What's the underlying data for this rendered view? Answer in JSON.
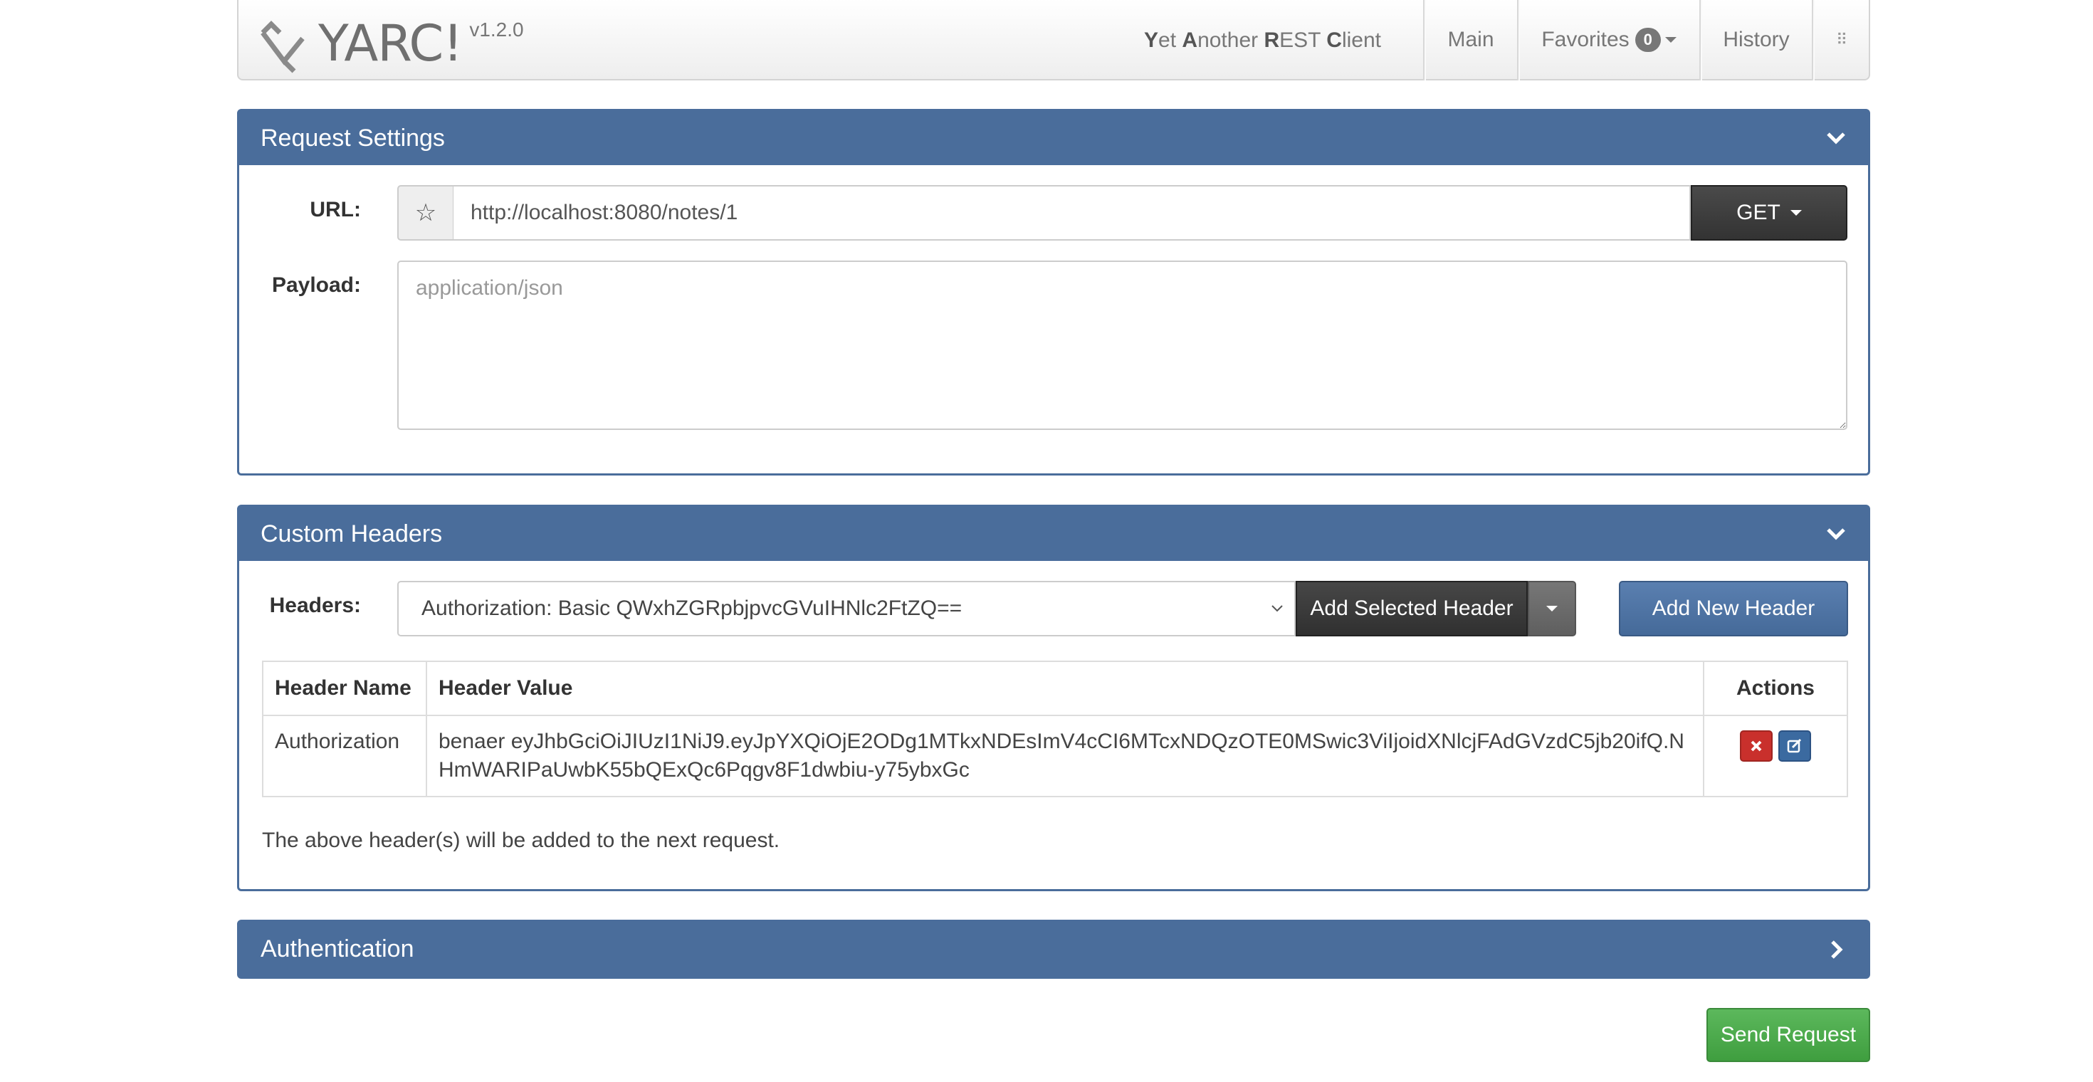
{
  "navbar": {
    "brand_name": "YARC!",
    "version": "v1.2.0",
    "tagline": {
      "y": "Y",
      "et": "et ",
      "a": "A",
      "nother": "nother ",
      "r": "R",
      "est": "EST ",
      "c": "C",
      "lient": "lient"
    },
    "main_label": "Main",
    "favorites_label": "Favorites",
    "favorites_count": "0",
    "history_label": "History",
    "grip_icon": "⠿"
  },
  "request_settings": {
    "title": "Request Settings",
    "url_label": "URL:",
    "url_value": "http://localhost:8080/notes/1",
    "favorite_icon": "☆",
    "method_label": "GET",
    "payload_label": "Payload:",
    "payload_placeholder": "application/json",
    "payload_value": ""
  },
  "custom_headers": {
    "title": "Custom Headers",
    "headers_label": "Headers:",
    "selected_header": "Authorization: Basic QWxhZGRpbjpvcGVuIHNlc2FtZQ==",
    "add_selected_label": "Add Selected Header",
    "add_new_label": "Add New Header",
    "columns": [
      "Header Name",
      "Header Value",
      "Actions"
    ],
    "rows": [
      {
        "name": "Authorization",
        "value": "benaer eyJhbGciOiJIUzI1NiJ9.eyJpYXQiOjE2ODg1MTkxNDEsImV4cCI6MTcxNDQzOTE0MSwic3ViIjoidXNlcjFAdGVzdC5jb20ifQ.NHmWARIPaUwbK55bQExQc6Pqgv8F1dwbiu-y75ybxGc"
      }
    ],
    "note": "The above header(s) will be added to the next request."
  },
  "authentication": {
    "title": "Authentication"
  },
  "send_label": "Send Request",
  "colors": {
    "panel_primary": "#4a6d9b",
    "send_green": "#5cb85c",
    "delete_red": "#c9302c"
  }
}
